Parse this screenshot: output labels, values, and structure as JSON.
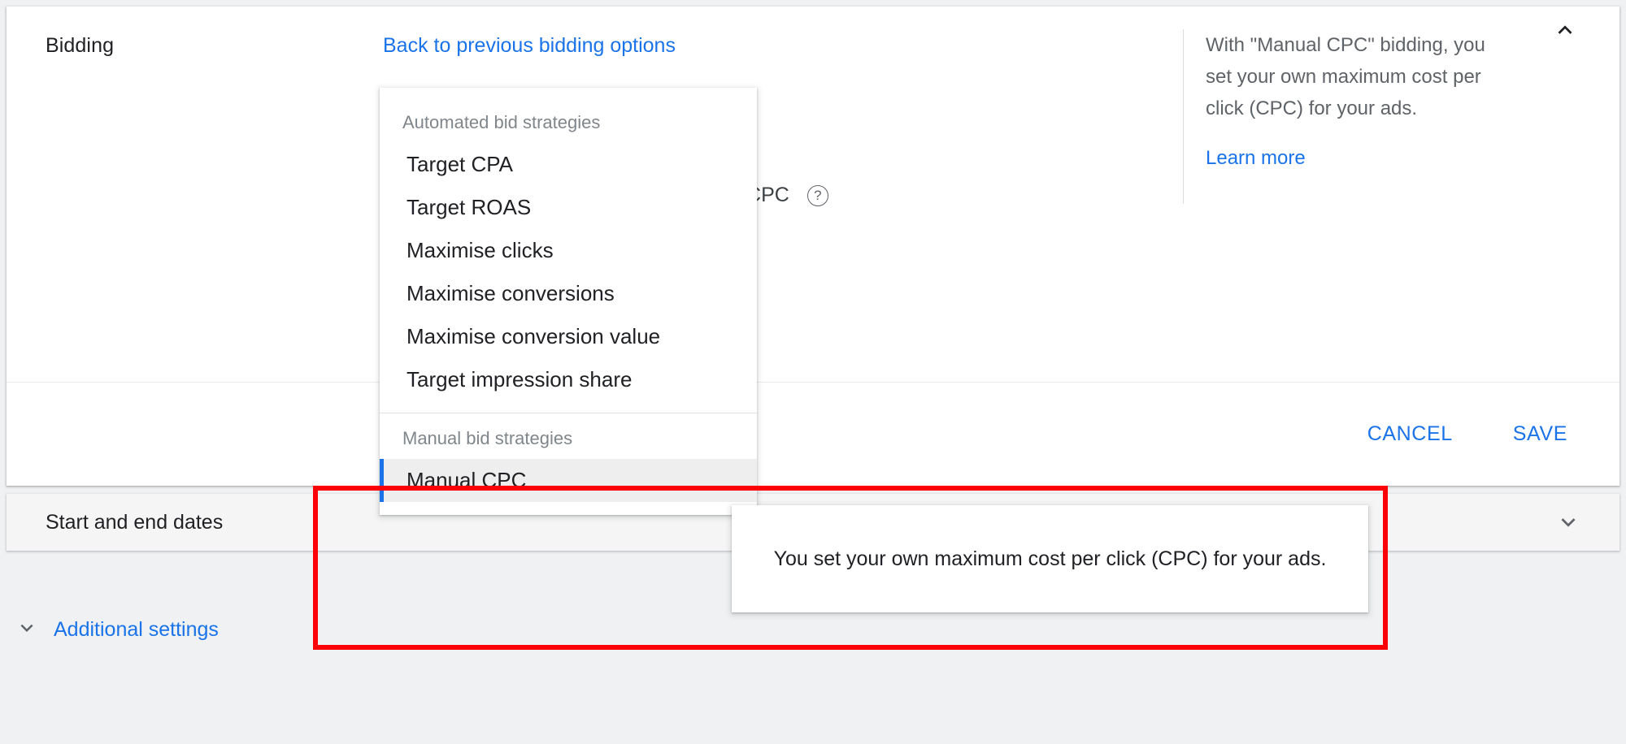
{
  "bidding_card": {
    "section_label": "Bidding",
    "back_link": "Back to previous bidding options",
    "obscured_option_label": "anced CPC",
    "help_icon": "help-circle-icon",
    "collapse_icon": "chevron-up-icon",
    "info_panel": {
      "text": "With \"Manual CPC\" bidding, you set your own maximum cost per click (CPC) for your ads.",
      "learn_more": "Learn more"
    },
    "footer": {
      "cancel_label": "CANCEL",
      "save_label": "SAVE"
    }
  },
  "bid_strategy_dropdown": {
    "automated_group_label": "Automated bid strategies",
    "automated_items": [
      {
        "label": "Target CPA"
      },
      {
        "label": "Target ROAS"
      },
      {
        "label": "Maximise clicks"
      },
      {
        "label": "Maximise conversions"
      },
      {
        "label": "Maximise conversion value"
      },
      {
        "label": "Target impression share"
      }
    ],
    "manual_group_label": "Manual bid strategies",
    "manual_items": [
      {
        "label": "Manual CPC",
        "selected": true
      }
    ]
  },
  "tooltip": {
    "text": "You set your own maximum cost per click (CPC) for your ads."
  },
  "dates_card": {
    "label": "Start and end dates",
    "expand_icon": "chevron-down-icon"
  },
  "additional_settings": {
    "label": "Additional settings",
    "expand_icon": "chevron-down-icon"
  },
  "colors": {
    "accent_blue": "#1a73e8",
    "annotation_red": "#fb0007",
    "page_background": "#eff1f3",
    "card_grey": "#f5f5f5",
    "selected_row_grey": "#eeeeee"
  }
}
